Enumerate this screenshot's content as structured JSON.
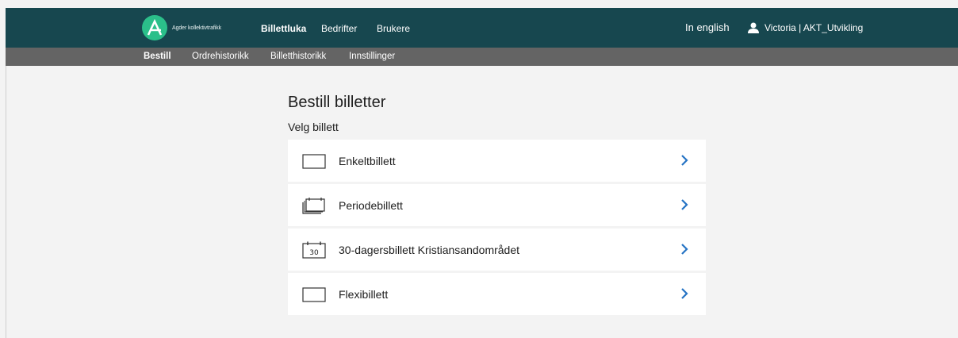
{
  "header": {
    "logo_text": "Agder kollektivtrafikk",
    "nav": [
      "Billettluka",
      "Bedrifter",
      "Brukere"
    ],
    "language_link": "In english",
    "user": "Victoria | AKT_Utvikling"
  },
  "subnav": [
    "Bestill",
    "Ordrehistorikk",
    "Billetthistorikk",
    "Innstillinger"
  ],
  "main": {
    "title": "Bestill billetter",
    "subtitle": "Velg billett",
    "tickets": [
      {
        "label": "Enkeltbillett",
        "icon": "ticket-icon"
      },
      {
        "label": "Periodebillett",
        "icon": "period-ticket-icon"
      },
      {
        "label": "30-dagersbillett Kristiansandområdet",
        "icon": "calendar-30-icon",
        "icon_text": "30"
      },
      {
        "label": "Flexibillett",
        "icon": "ticket-icon"
      }
    ]
  },
  "colors": {
    "topbar": "#17474f",
    "subbar": "#646464",
    "logo": "#2bbf8a",
    "chevron": "#2573c4"
  }
}
